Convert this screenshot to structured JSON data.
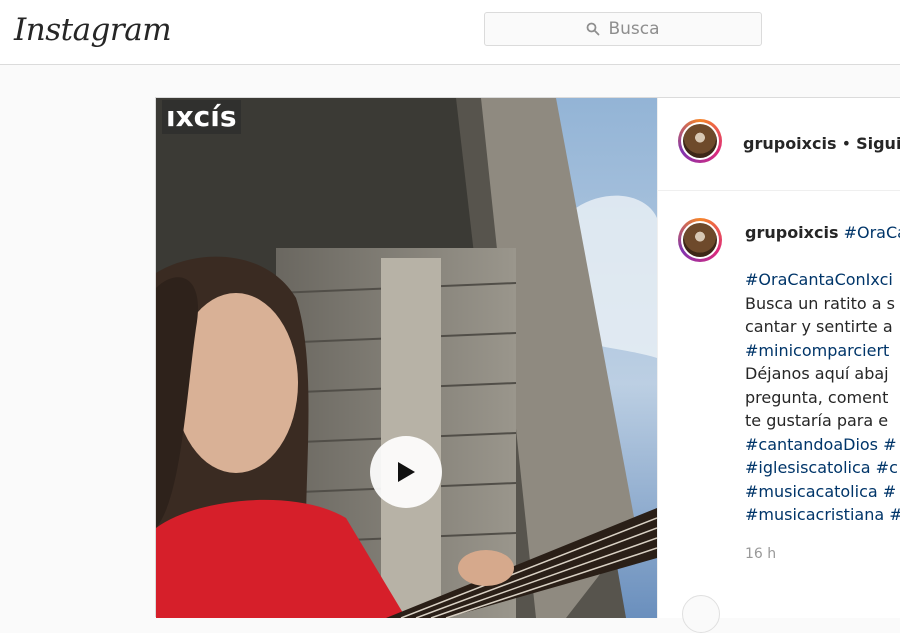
{
  "header": {
    "logo_text": "Instagram",
    "search_placeholder": "Busca",
    "search_icon": "search-icon"
  },
  "post": {
    "media": {
      "watermark": "ıxcís",
      "play_icon": "play-icon"
    },
    "author": {
      "username": "grupoixcis",
      "separator": " • ",
      "follow_label": "Siguie"
    },
    "caption": {
      "username": "grupoixcis",
      "first_tag": "#OraCa",
      "lines": [
        "#OraCantaConIxci",
        "Busca un ratito a s",
        "cantar y sentirte a",
        "#minicomparciert",
        "Déjanos aquí abaj",
        "pregunta, coment",
        "te gustaría para e",
        "#cantandoaDios #",
        "#iglesiscatolica #c",
        "#musicacatolica #",
        "#musicacristiana #"
      ],
      "timestamp": "16 h"
    },
    "colors": {
      "hashtag": "#003569",
      "timestamp": "#999999",
      "border": "#dbdbdb"
    }
  }
}
